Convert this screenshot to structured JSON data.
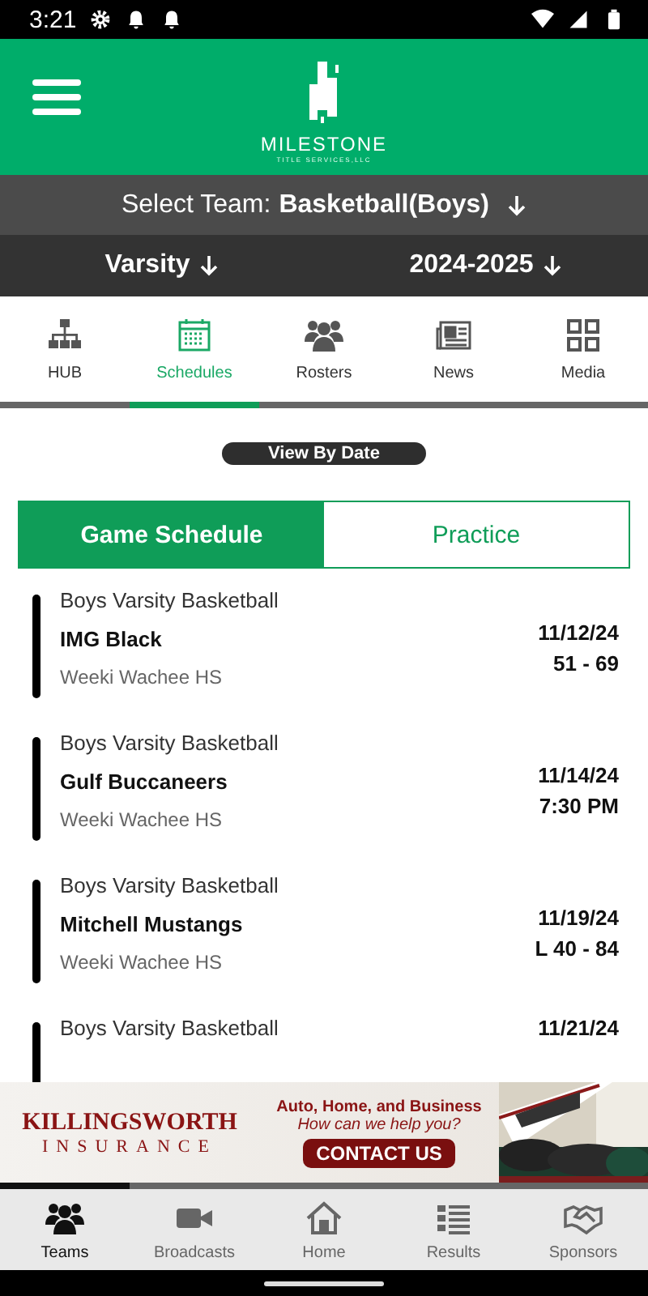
{
  "status_bar": {
    "time": "3:21"
  },
  "header": {
    "logo_name": "MILESTONE",
    "logo_tagline": "TITLE SERVICES,LLC"
  },
  "team_select": {
    "label": "Select Team:",
    "value": "Basketball(Boys)"
  },
  "filters": [
    {
      "value": "Varsity"
    },
    {
      "value": "2024-2025"
    }
  ],
  "tabs": [
    {
      "label": "HUB",
      "selected": false
    },
    {
      "label": "Schedules",
      "selected": true
    },
    {
      "label": "Rosters",
      "selected": false
    },
    {
      "label": "News",
      "selected": false
    },
    {
      "label": "Media",
      "selected": false
    }
  ],
  "view_button": "View By Date",
  "segments": [
    {
      "label": "Game Schedule",
      "selected": true
    },
    {
      "label": "Practice",
      "selected": false
    }
  ],
  "games": [
    {
      "title": "Boys Varsity Basketball",
      "opponent": "IMG Black",
      "location": "Weeki Wachee HS",
      "date": "11/12/24",
      "result": "51 - 69"
    },
    {
      "title": "Boys Varsity Basketball",
      "opponent": "Gulf Buccaneers",
      "location": "Weeki Wachee HS",
      "date": "11/14/24",
      "result": "7:30 PM"
    },
    {
      "title": "Boys Varsity Basketball",
      "opponent": "Mitchell Mustangs",
      "location": "Weeki Wachee HS",
      "date": "11/19/24",
      "result": "L 40 - 84"
    },
    {
      "title": "Boys Varsity Basketball",
      "date": "11/21/24"
    }
  ],
  "ad": {
    "brand_top": "KILLINGSWORTH",
    "brand_bottom": "INSURANCE",
    "headline": "Auto, Home, and Business",
    "question": "How can we help you?",
    "cta": "CONTACT US",
    "level": 0.2
  },
  "bottom_nav": [
    {
      "label": "Teams",
      "selected": true
    },
    {
      "label": "Broadcasts",
      "selected": false
    },
    {
      "label": "Home",
      "selected": false
    },
    {
      "label": "Results",
      "selected": false
    },
    {
      "label": "Sponsors",
      "selected": false
    }
  ]
}
